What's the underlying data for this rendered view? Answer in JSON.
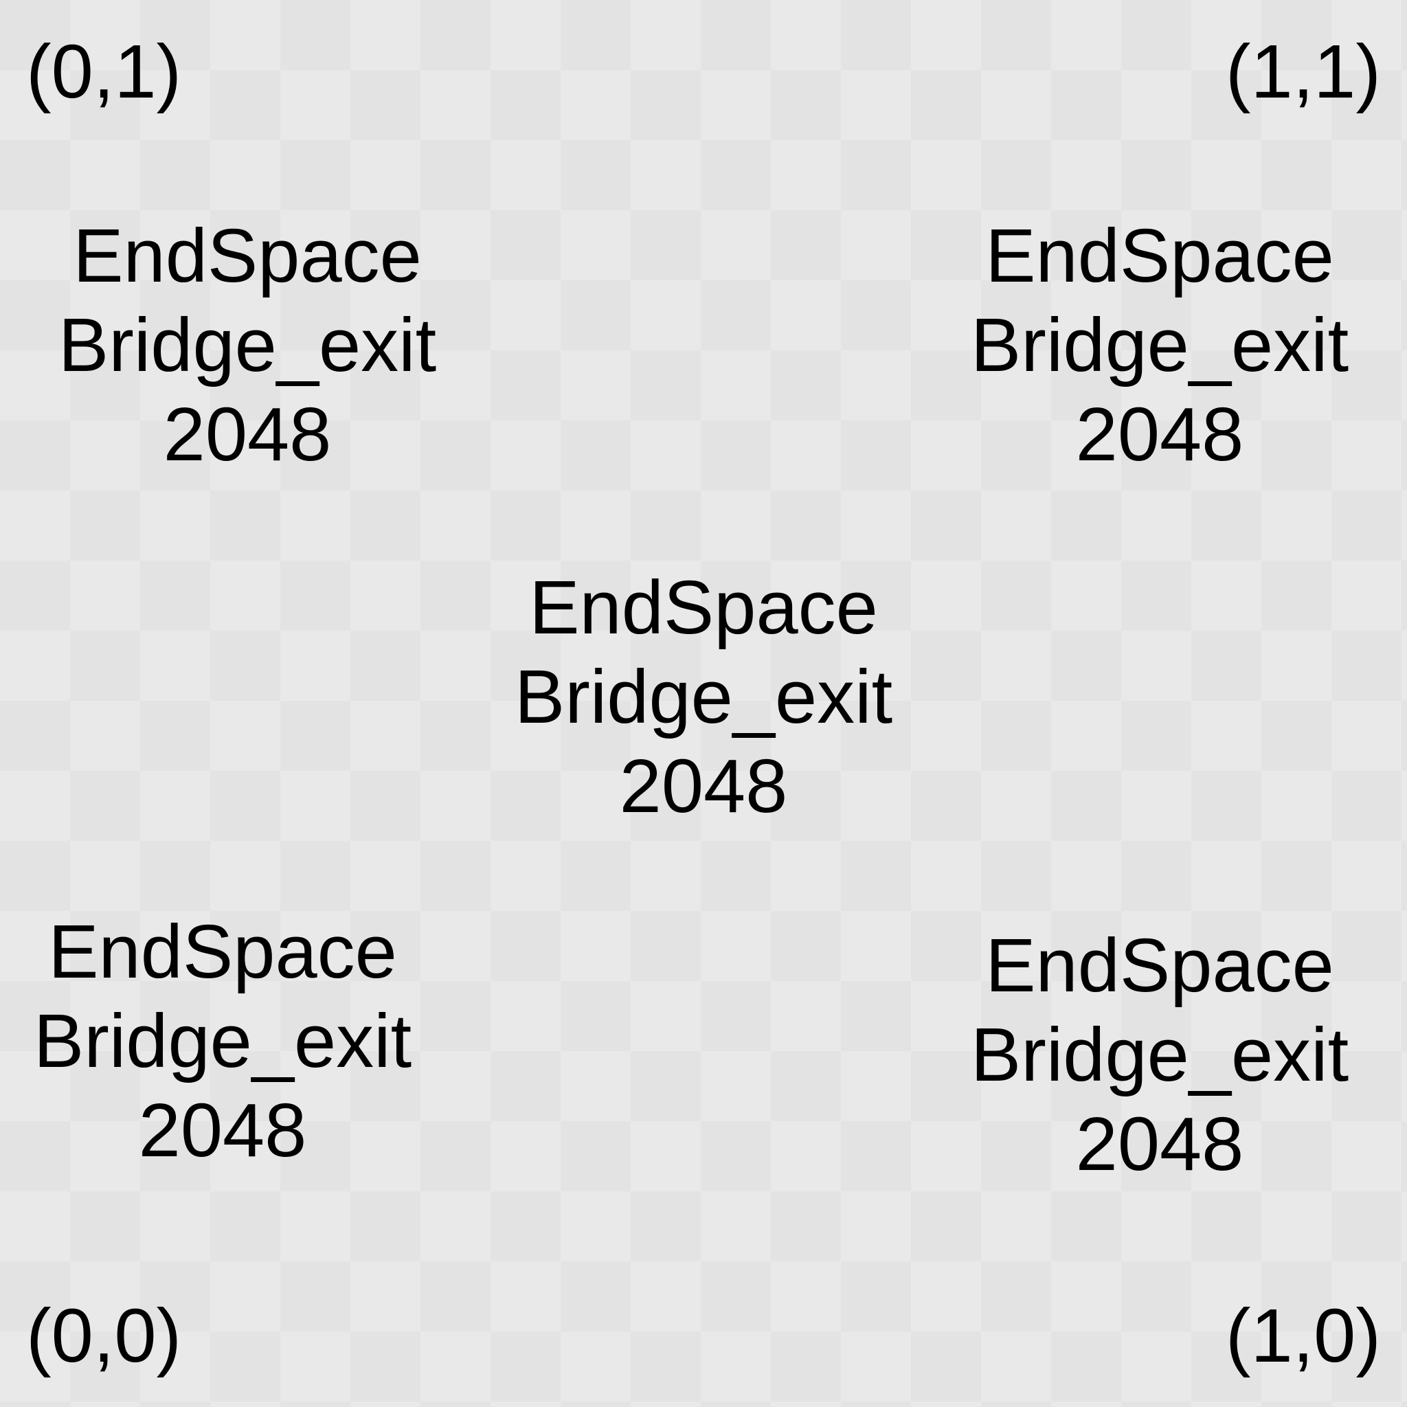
{
  "corners": {
    "top_left": "(0,1)",
    "top_right": "(1,1)",
    "bottom_left": "(0,0)",
    "bottom_right": "(1,0)"
  },
  "label": {
    "line1": "EndSpace",
    "line2": "Bridge_exit",
    "line3": "2048"
  }
}
